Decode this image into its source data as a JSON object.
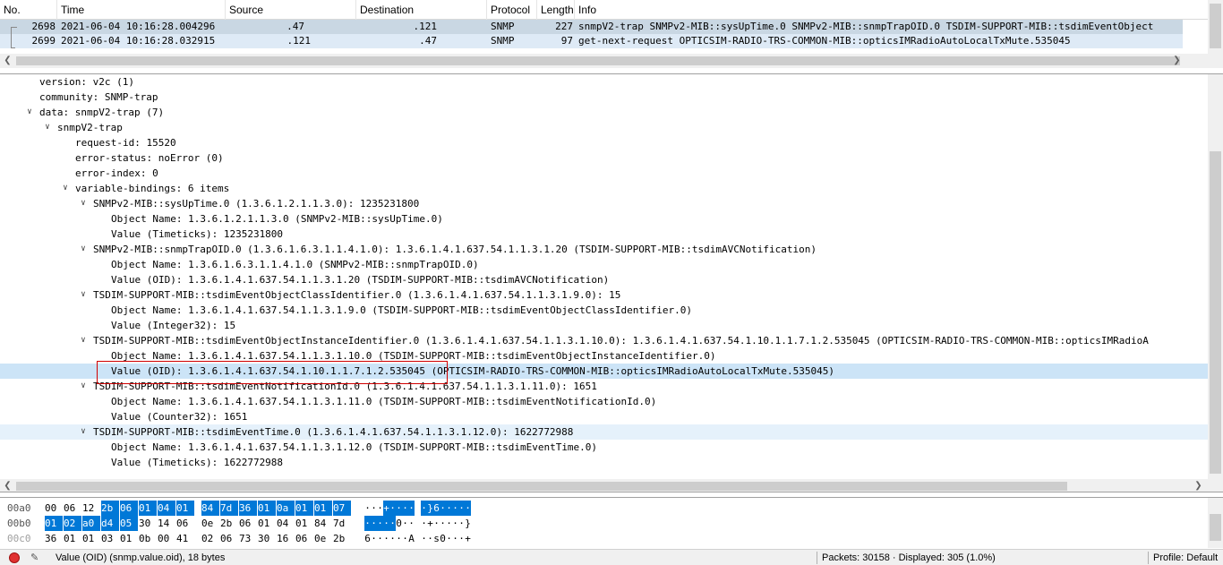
{
  "packet_list": {
    "columns": [
      "No.",
      "Time",
      "Source",
      "Destination",
      "Protocol",
      "Length",
      "Info"
    ],
    "rows": [
      {
        "no": "2698",
        "time": "2021-06-04 10:16:28.004296",
        "source": ".47",
        "destination": ".121",
        "protocol": "SNMP",
        "length": "227",
        "info": "snmpV2-trap SNMPv2-MIB::sysUpTime.0 SNMPv2-MIB::snmpTrapOID.0 TSDIM-SUPPORT-MIB::tsdimEventObject"
      },
      {
        "no": "2699",
        "time": "2021-06-04 10:16:28.032915",
        "source": ".121",
        "destination": ".47",
        "protocol": "SNMP",
        "length": "97",
        "info": "get-next-request OPTICSIM-RADIO-TRS-COMMON-MIB::opticsIMRadioAutoLocalTxMute.535045"
      }
    ]
  },
  "details": {
    "lines": [
      {
        "text": "version: v2c (1)",
        "toggle": ""
      },
      {
        "text": "community: SNMP-trap",
        "toggle": ""
      },
      {
        "text": "data: snmpV2-trap (7)",
        "toggle": "v"
      },
      {
        "text": "snmpV2-trap",
        "toggle": "v"
      },
      {
        "text": "request-id: 15520",
        "toggle": ""
      },
      {
        "text": "error-status: noError (0)",
        "toggle": ""
      },
      {
        "text": "error-index: 0",
        "toggle": ""
      },
      {
        "text": "variable-bindings: 6 items",
        "toggle": "v"
      },
      {
        "text": "SNMPv2-MIB::sysUpTime.0 (1.3.6.1.2.1.1.3.0): 1235231800",
        "toggle": "v"
      },
      {
        "text": "Object Name: 1.3.6.1.2.1.1.3.0 (SNMPv2-MIB::sysUpTime.0)",
        "toggle": ""
      },
      {
        "text": "Value (Timeticks): 1235231800",
        "toggle": ""
      },
      {
        "text": "SNMPv2-MIB::snmpTrapOID.0 (1.3.6.1.6.3.1.1.4.1.0): 1.3.6.1.4.1.637.54.1.1.3.1.20 (TSDIM-SUPPORT-MIB::tsdimAVCNotification)",
        "toggle": "v"
      },
      {
        "text": "Object Name: 1.3.6.1.6.3.1.1.4.1.0 (SNMPv2-MIB::snmpTrapOID.0)",
        "toggle": ""
      },
      {
        "text": "Value (OID): 1.3.6.1.4.1.637.54.1.1.3.1.20 (TSDIM-SUPPORT-MIB::tsdimAVCNotification)",
        "toggle": ""
      },
      {
        "text": "TSDIM-SUPPORT-MIB::tsdimEventObjectClassIdentifier.0 (1.3.6.1.4.1.637.54.1.1.3.1.9.0): 15",
        "toggle": "v"
      },
      {
        "text": "Object Name: 1.3.6.1.4.1.637.54.1.1.3.1.9.0 (TSDIM-SUPPORT-MIB::tsdimEventObjectClassIdentifier.0)",
        "toggle": ""
      },
      {
        "text": "Value (Integer32): 15",
        "toggle": ""
      },
      {
        "text": "TSDIM-SUPPORT-MIB::tsdimEventObjectInstanceIdentifier.0 (1.3.6.1.4.1.637.54.1.1.3.1.10.0): 1.3.6.1.4.1.637.54.1.10.1.1.7.1.2.535045 (OPTICSIM-RADIO-TRS-COMMON-MIB::opticsIMRadioA",
        "toggle": "v"
      },
      {
        "text": "Object Name: 1.3.6.1.4.1.637.54.1.1.3.1.10.0 (TSDIM-SUPPORT-MIB::tsdimEventObjectInstanceIdentifier.0)",
        "toggle": ""
      },
      {
        "text": "Value (OID): 1.3.6.1.4.1.637.54.1.10.1.1.7.1.2.535045 (OPTICSIM-RADIO-TRS-COMMON-MIB::opticsIMRadioAutoLocalTxMute.535045)",
        "toggle": ""
      },
      {
        "text": "TSDIM-SUPPORT-MIB::tsdimEventNotificationId.0 (1.3.6.1.4.1.637.54.1.1.3.1.11.0): 1651",
        "toggle": "v"
      },
      {
        "text": "Object Name: 1.3.6.1.4.1.637.54.1.1.3.1.11.0 (TSDIM-SUPPORT-MIB::tsdimEventNotificationId.0)",
        "toggle": ""
      },
      {
        "text": "Value (Counter32): 1651",
        "toggle": ""
      },
      {
        "text": "TSDIM-SUPPORT-MIB::tsdimEventTime.0 (1.3.6.1.4.1.637.54.1.1.3.1.12.0): 1622772988",
        "toggle": "v"
      },
      {
        "text": "Object Name: 1.3.6.1.4.1.637.54.1.1.3.1.12.0 (TSDIM-SUPPORT-MIB::tsdimEventTime.0)",
        "toggle": ""
      },
      {
        "text": "Value (Timeticks): 1622772988",
        "toggle": ""
      }
    ]
  },
  "hex": {
    "rows": [
      {
        "offset": "00a0",
        "bytes": [
          "00",
          "06",
          "12",
          "2b",
          "06",
          "01",
          "04",
          "01",
          "84",
          "7d",
          "36",
          "01",
          "0a",
          "01",
          "01",
          "07"
        ],
        "ascii": [
          "·",
          "·",
          "·",
          "+",
          "·",
          "·",
          "·",
          "·",
          "·",
          "}",
          "6",
          "·",
          "·",
          "·",
          "·",
          "·"
        ]
      },
      {
        "offset": "00b0",
        "bytes": [
          "01",
          "02",
          "a0",
          "d4",
          "05",
          "30",
          "14",
          "06",
          "0e",
          "2b",
          "06",
          "01",
          "04",
          "01",
          "84",
          "7d"
        ],
        "ascii": [
          "·",
          "·",
          "·",
          "·",
          "·",
          "0",
          "·",
          "·",
          "·",
          "+",
          "·",
          "·",
          "·",
          "·",
          "·",
          "}"
        ]
      },
      {
        "offset": "00c0",
        "bytes": [
          "36",
          "01",
          "01",
          "03",
          "01",
          "0b",
          "00",
          "41",
          "02",
          "06",
          "73",
          "30",
          "16",
          "06",
          "0e",
          "2b"
        ],
        "ascii": [
          "6",
          "·",
          "·",
          "·",
          "·",
          "·",
          "·",
          "A",
          "·",
          "·",
          "s",
          "0",
          "·",
          "·",
          "·",
          "+"
        ]
      }
    ]
  },
  "statusbar": {
    "field_info": "Value (OID) (snmp.value.oid), 18 bytes",
    "packets": "Packets: 30158 · Displayed: 305 (1.0%)",
    "profile": "Profile: Default"
  },
  "colors": {
    "selected_row": "#c9d7e3",
    "related_row": "#deeaf6",
    "hex_selection": "#0078d7",
    "highlight_box": "#d00000"
  }
}
